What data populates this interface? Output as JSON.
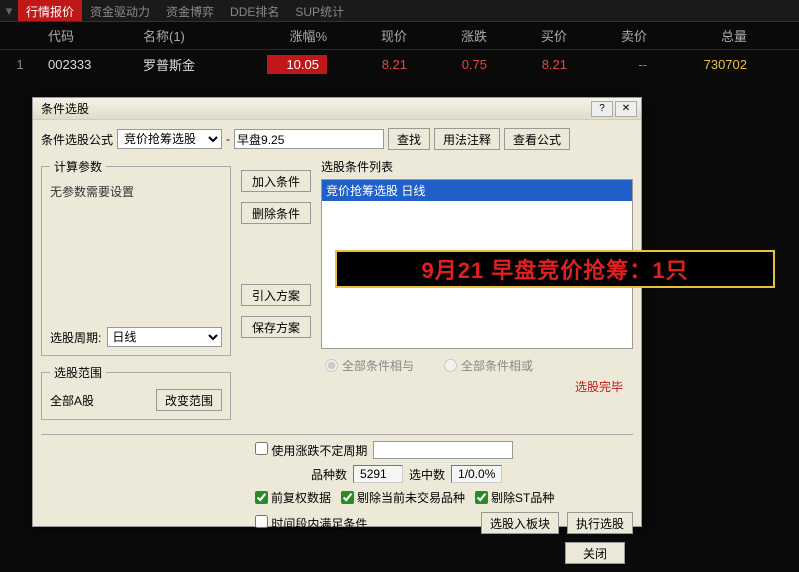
{
  "tabs": {
    "active": "行情报价",
    "items": [
      "行情报价",
      "资金驱动力",
      "资金博弈",
      "DDE排名",
      "SUP统计"
    ]
  },
  "table": {
    "headers": {
      "code": "代码",
      "name": "名称(1)",
      "pct": "涨幅%",
      "price": "现价",
      "chg": "涨跌",
      "bid": "买价",
      "ask": "卖价",
      "vol": "总量"
    },
    "row": {
      "idx": "1",
      "code": "002333",
      "name": "罗普斯金",
      "pct": "10.05",
      "price": "8.21",
      "chg": "0.75",
      "bid": "8.21",
      "ask": "--",
      "vol": "730702"
    }
  },
  "dialog": {
    "title": "条件选股",
    "formula_label": "条件选股公式",
    "formula_name": "竞价抢筹选股",
    "formula_dash": "-",
    "formula_desc": "早盘9.25",
    "btn_search": "查找",
    "btn_usage": "用法注释",
    "btn_view": "查看公式",
    "param_legend": "计算参数",
    "param_none": "无参数需要设置",
    "period_label": "选股周期:",
    "period_value": "日线",
    "scope_legend": "选股范围",
    "scope_value": "全部A股",
    "btn_scope": "改变范围",
    "btn_add": "加入条件",
    "btn_del": "删除条件",
    "btn_import": "引入方案",
    "btn_save": "保存方案",
    "cond_list_label": "选股条件列表",
    "cond_item": "竞价抢筹选股   日线",
    "radio_and": "全部条件相与",
    "radio_or": "全部条件相或",
    "status": "选股完毕",
    "chk_custom_period": "使用涨跌不定周期",
    "count_label": "品种数",
    "count_val": "5291",
    "selected_label": "选中数",
    "selected_val": "1/0.0%",
    "chk_fq": "前复权数据",
    "chk_rm_nontrade": "剔除当前未交易品种",
    "chk_rm_st": "剔除ST品种",
    "chk_time": "时间段内满足条件",
    "btn_block": "选股入板块",
    "btn_exec": "执行选股",
    "btn_close": "关闭"
  },
  "banner": "9月21 早盘竞价抢筹：1只"
}
